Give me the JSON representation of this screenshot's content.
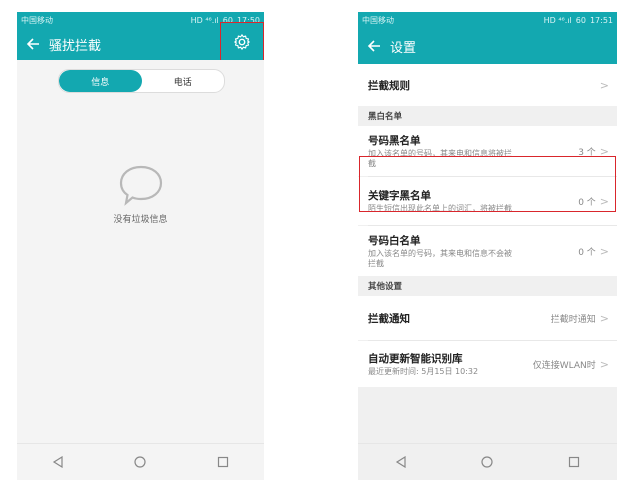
{
  "left_phone": {
    "status": {
      "carrier": "中国移动",
      "signal": "HD ⁴⁶.ıl",
      "battery": "60",
      "time": "17:50"
    },
    "title": "骚扰拦截",
    "tabs": [
      {
        "label": "信息",
        "active": true
      },
      {
        "label": "电话",
        "active": false
      }
    ],
    "empty_text": "没有垃圾信息"
  },
  "right_phone": {
    "status": {
      "carrier": "中国移动",
      "signal": "HD ⁴⁶.ıl",
      "battery": "60",
      "time": "17:51"
    },
    "title": "设置",
    "rule": {
      "label": "拦截规则"
    },
    "section_blackwhite": "黑白名单",
    "number_blacklist": {
      "title": "号码黑名单",
      "sub": "加入该名单的号码，其来电和信息将被拦截",
      "value": "3 个"
    },
    "keyword_blacklist": {
      "title": "关键字黑名单",
      "sub": "陌生短信出现此名单上的词汇，将被拦截",
      "value": "0 个"
    },
    "number_whitelist": {
      "title": "号码白名单",
      "sub": "加入该名单的号码，其来电和信息不会被拦截",
      "value": "0 个"
    },
    "section_other": "其他设置",
    "notify": {
      "title": "拦截通知",
      "value": "拦截时通知"
    },
    "auto_update": {
      "title": "自动更新智能识别库",
      "sub": "最近更新时间: 5月15日 10:32",
      "value": "仅连接WLAN时"
    }
  },
  "colors": {
    "accent": "#13a8b0",
    "highlight": "#d9262c"
  }
}
